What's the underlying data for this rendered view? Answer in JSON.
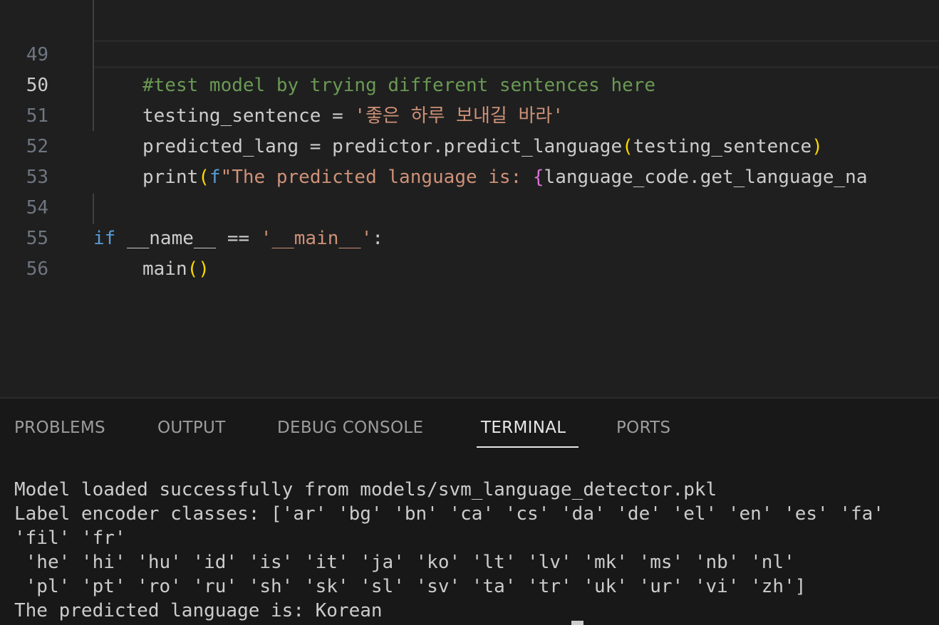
{
  "editor": {
    "active_line": "50",
    "lines": [
      {
        "number": "49",
        "tokens": {
          "comment": "#test model by trying different sentences here"
        }
      },
      {
        "number": "50",
        "tokens": {
          "var": "testing_sentence",
          "eq": " = ",
          "str": "'좋은 하루 보내길 바라'"
        }
      },
      {
        "number": "51",
        "tokens": {
          "pre": "predicted_lang = predictor.predict_language",
          "open": "(",
          "arg": "testing_sentence",
          "close": ")"
        }
      },
      {
        "number": "52",
        "tokens": {
          "fn": "print",
          "open": "(",
          "fprefix": "f",
          "str": "\"The predicted language is: ",
          "brace": "{",
          "rest": "language_code.get_language_na"
        }
      },
      {
        "number": "53"
      },
      {
        "number": "54",
        "tokens": {
          "kw": "if",
          "mid": " __name__ == ",
          "str": "'__main__'",
          "colon": ":"
        }
      },
      {
        "number": "55",
        "tokens": {
          "fn": "main",
          "parens": "()"
        }
      },
      {
        "number": "56"
      }
    ]
  },
  "panel": {
    "tabs": [
      {
        "label": "PROBLEMS"
      },
      {
        "label": "OUTPUT"
      },
      {
        "label": "DEBUG CONSOLE"
      },
      {
        "label": "TERMINAL"
      },
      {
        "label": "PORTS"
      }
    ],
    "active_tab": "TERMINAL",
    "terminal_lines": [
      "Model loaded successfully from models/svm_language_detector.pkl",
      "Label encoder classes: ['ar' 'bg' 'bn' 'ca' 'cs' 'da' 'de' 'el' 'en' 'es' 'fa'",
      "'fil' 'fr'",
      " 'he' 'hi' 'hu' 'id' 'is' 'it' 'ja' 'ko' 'lt' 'lv' 'mk' 'ms' 'nb' 'nl'",
      " 'pl' 'pt' 'ro' 'ru' 'sh' 'sk' 'sl' 'sv' 'ta' 'tr' 'uk' 'ur' 'vi' 'zh']",
      "The predicted language is: Korean"
    ]
  },
  "colors": {
    "editor_bg": "#1f1f1f",
    "panel_bg": "#181818",
    "comment": "#6a9955",
    "string": "#ce9178",
    "keyword": "#569cd6",
    "bracket_level1": "#ffd700",
    "bracket_level2": "#da70d6"
  }
}
